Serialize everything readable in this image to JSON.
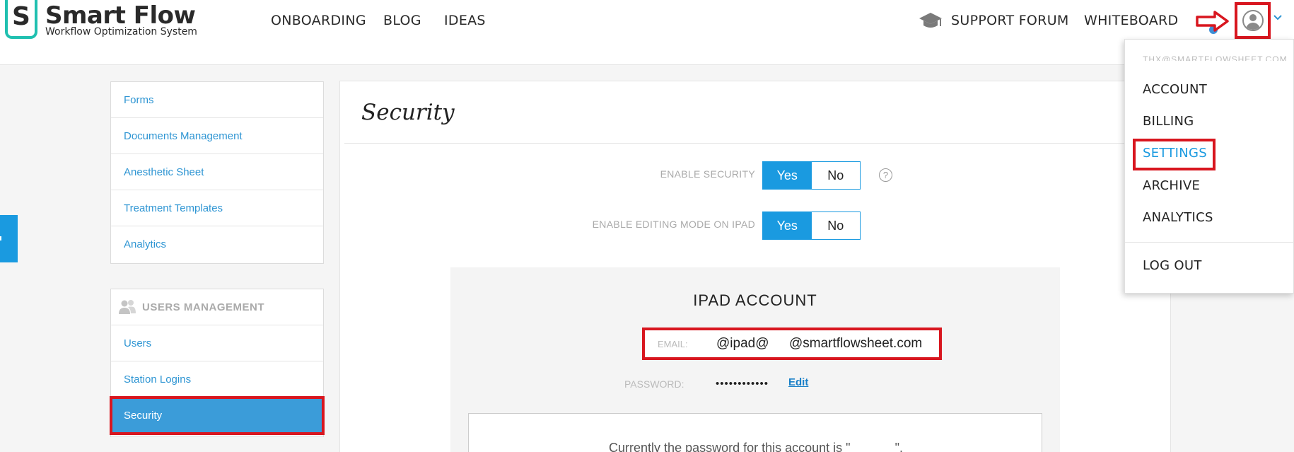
{
  "brand": {
    "badge_letter": "S",
    "name": "Smart Flow",
    "tagline": "Workflow Optimization System"
  },
  "nav": {
    "onboarding": "ONBOARDING",
    "blog": "BLOG",
    "ideas": "IDEAS",
    "support_forum": "SUPPORT FORUM",
    "whiteboard": "WHITEBOARD"
  },
  "sidebar": {
    "settings_items": [
      {
        "label": "Forms"
      },
      {
        "label": "Documents Management"
      },
      {
        "label": "Anesthetic Sheet"
      },
      {
        "label": "Treatment Templates"
      },
      {
        "label": "Analytics"
      }
    ],
    "users_header": "USERS MANAGEMENT",
    "users_items": [
      {
        "label": "Users"
      },
      {
        "label": "Station Logins"
      },
      {
        "label": "Security"
      }
    ]
  },
  "main": {
    "title": "Security",
    "enable_security": {
      "label": "ENABLE SECURITY",
      "yes": "Yes",
      "no": "No",
      "selected": "Yes"
    },
    "enable_editing": {
      "label": "ENABLE EDITING MODE ON IPAD",
      "yes": "Yes",
      "no": "No",
      "selected": "Yes"
    },
    "help_icon_glyph": "?",
    "ipad_account": {
      "title": "IPAD ACCOUNT",
      "email_label": "EMAIL:",
      "email_value": "@ipad@   @smartflowsheet.com",
      "password_label": "PASSWORD:",
      "password_value": "••••••••••••",
      "edit_label": "Edit",
      "notice": "Currently the password for this account is \"       \"."
    }
  },
  "user_menu": {
    "email": "THX@SMARTFLOWSHEET.COM",
    "items": [
      {
        "label": "ACCOUNT"
      },
      {
        "label": "BILLING"
      },
      {
        "label": "SETTINGS"
      },
      {
        "label": "ARCHIVE"
      },
      {
        "label": "ANALYTICS"
      }
    ],
    "logout": "LOG OUT"
  },
  "colors": {
    "accent": "#1a9ae0",
    "link": "#2e95d3",
    "annotation_red": "#d8161f",
    "logo_teal": "#20c0b0"
  }
}
